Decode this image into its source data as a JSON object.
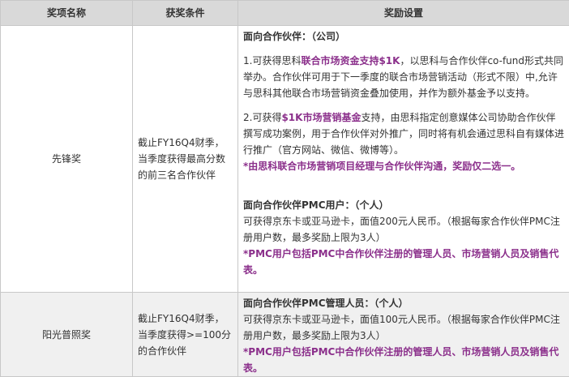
{
  "headers": {
    "name": "奖项名称",
    "condition": "获奖条件",
    "reward": "奖励设置"
  },
  "rows": [
    {
      "name": "先锋奖",
      "condition": "截止FY16Q4财季，当季度获得最高分数的前三名合作伙伴",
      "reward": {
        "company_title": "面向合作伙伴：（公司）",
        "item1_a": "1.可获得思科",
        "item1_b": "联合市场资金支持$1K",
        "item1_c": "，以思科与合作伙伴co-fund形式共同举办。合作伙伴可用于下一季度的联合市场营销活动（形式不限）中,允许与思科其他联合市场营销资金叠加使用，并作为额外基金予以支持。",
        "item2_a": "2.可获得",
        "item2_b": "$1K市场营销基金",
        "item2_c": "支持，由思科指定创意媒体公司协助合作伙伴撰写成功案例，用于合作伙伴对外推广，同时将有机会通过思科自有媒体进行推广（官方网站、微信、微博等）。",
        "note1": "*由思科联合市场营销项目经理与合作伙伴沟通，奖励仅二选一。",
        "pmc_title": "面向合作伙伴PMC用户：（个人）",
        "pmc_text": "可获得京东卡或亚马逊卡，面值200元人民币。（根据每家合作伙伴PMC注册用户数，最多奖励上限为3人）",
        "note2": "*PMC用户包括PMC中合作伙伴注册的管理人员、市场营销人员及销售代表。"
      }
    },
    {
      "name": "阳光普照奖",
      "condition": "截止FY16Q4财季，当季度获得>=100分的合作伙伴",
      "reward": {
        "title": "面向合作伙伴PMC管理人员：（个人）",
        "text": "可获得京东卡或亚马逊卡，面值100元人民币。（根据每家合作伙伴PMC注册用户数，最多奖励上限为3人）",
        "note": "*PMC用户包括PMC中合作伙伴注册的管理人员、市场营销人员及销售代表。"
      }
    }
  ]
}
